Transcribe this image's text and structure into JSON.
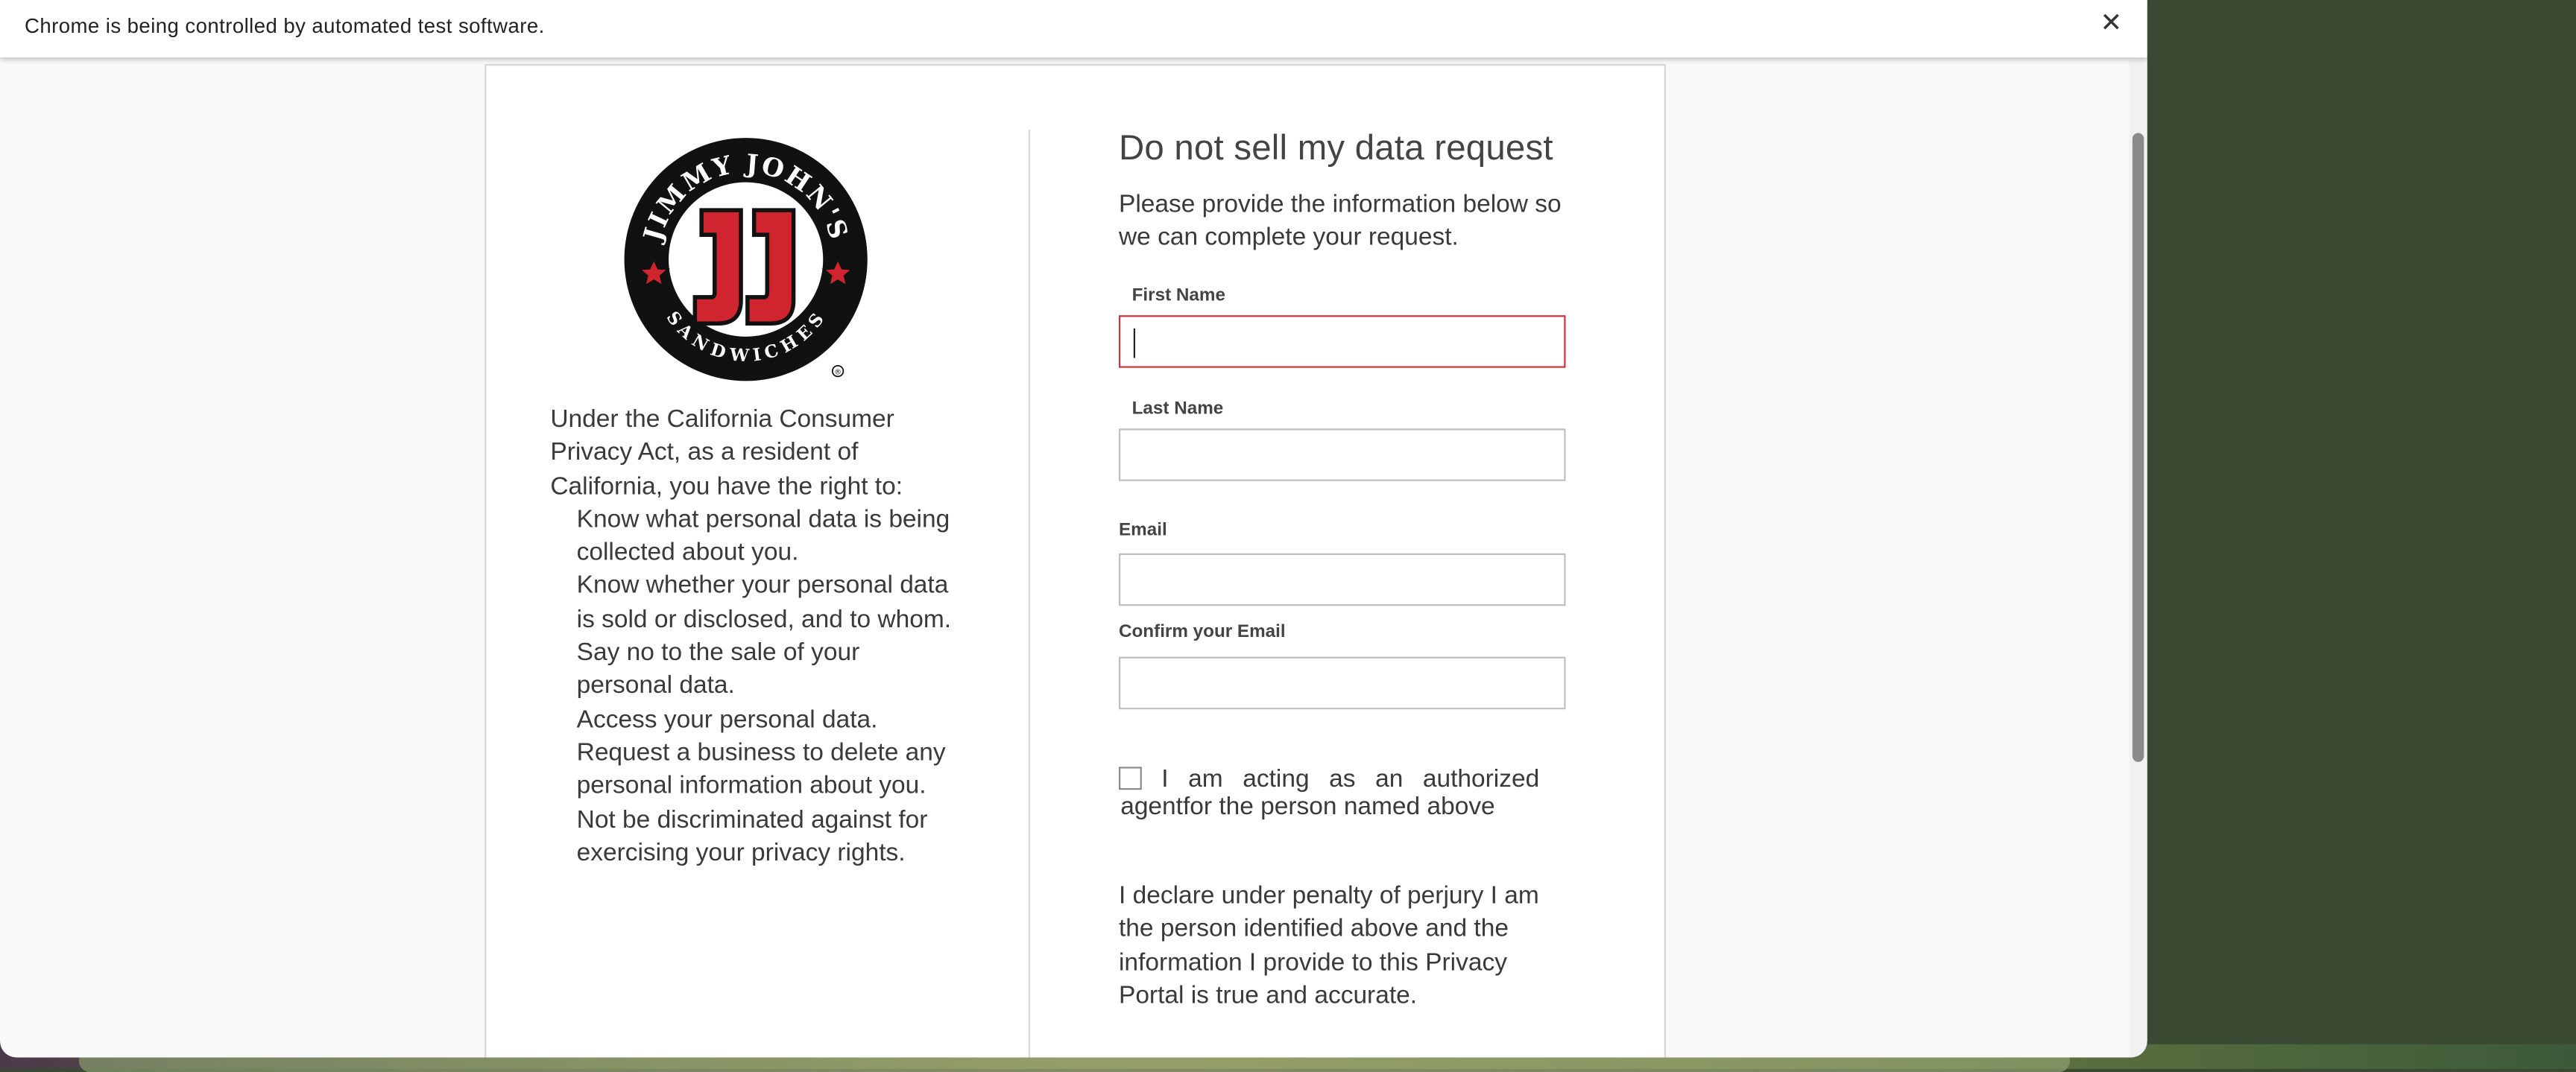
{
  "browser": {
    "infobar_text": "Chrome is being controlled by automated test software.",
    "close_icon": "close-icon"
  },
  "logo": {
    "brand_arc_top": "JIMMY JOHN'S",
    "brand_arc_bottom": "SANDWICHES",
    "monogram": "JJ",
    "registered": "®",
    "colors": {
      "ring": "#111111",
      "letters": "#d0252f",
      "stars": "#d0252f"
    }
  },
  "left": {
    "intro": "Under the California Consumer Privacy Act, as a resident of California, you have the right to:",
    "rights": [
      "Know what personal data is being collected about you.",
      "Know whether your personal data is sold or disclosed, and to whom.",
      "Say no to the sale of your personal data.",
      "Access your personal data.",
      "Request a business to delete any personal information about you.",
      "Not be discriminated against for exercising your privacy rights."
    ]
  },
  "form": {
    "title": "Do not sell my data request",
    "subtitle": "Please provide the information below so we can complete your request.",
    "first_name_label": "First Name",
    "first_name_value": "",
    "last_name_label": "Last Name",
    "last_name_value": "",
    "email_label": "Email",
    "email_value": "",
    "confirm_email_label": "Confirm your Email",
    "confirm_email_value": "",
    "agent_line1": "I am acting as an authorized",
    "agent_line2": "agentfor the person named above",
    "agent_checked": false,
    "declaration": "I declare under penalty of perjury I am the person identified above and the information I provide to this Privacy Portal is true and accurate."
  },
  "colors": {
    "accent_error": "#c8343f",
    "text": "#3a3a3a"
  }
}
